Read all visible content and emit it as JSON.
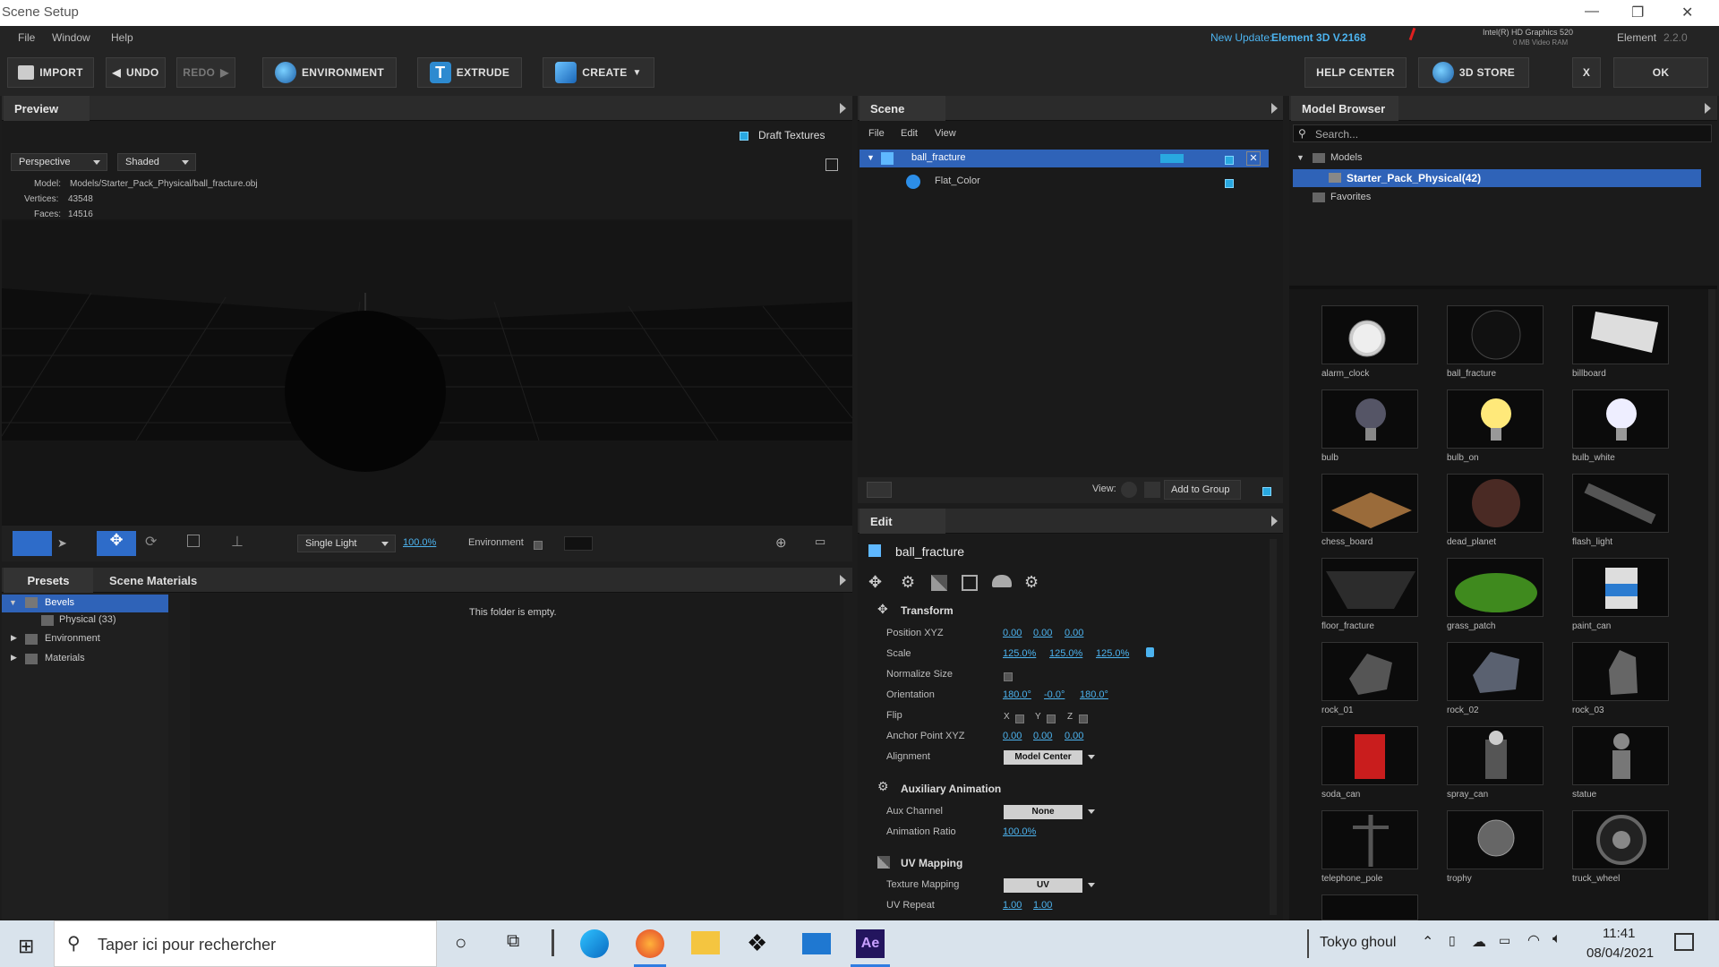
{
  "title": "Scene Setup",
  "menu": [
    "File",
    "Window",
    "Help"
  ],
  "update": {
    "prefix": "New Update:",
    "product": "Element 3D V.2168"
  },
  "gpu": {
    "name": "Intel(R) HD Graphics 520",
    "vram": "0 MB Video RAM"
  },
  "app": {
    "name": "Element",
    "version": "2.2.0"
  },
  "toolbar": {
    "import": "IMPORT",
    "undo": "UNDO",
    "redo": "REDO",
    "environment": "ENVIRONMENT",
    "extrude": "EXTRUDE",
    "create": "CREATE",
    "help": "HELP CENTER",
    "store": "3D STORE",
    "close": "X",
    "ok": "OK"
  },
  "preview": {
    "title": "Preview",
    "draft": "Draft Textures",
    "view": "Perspective",
    "shading": "Shaded",
    "model_label": "Model:",
    "model": "Models/Starter_Pack_Physical/ball_fracture.obj",
    "vertices_label": "Vertices:",
    "vertices": "43548",
    "faces_label": "Faces:",
    "faces": "14516",
    "light": "Single Light",
    "light_pct": "100.0%",
    "env": "Environment"
  },
  "presets": {
    "tab1": "Presets",
    "tab2": "Scene Materials",
    "tree": [
      "Bevels",
      "Physical (33)",
      "Environment",
      "Materials"
    ],
    "empty": "This folder is empty."
  },
  "scene": {
    "title": "Scene",
    "menu": [
      "File",
      "Edit",
      "View"
    ],
    "object": "ball_fracture",
    "material": "Flat_Color",
    "view": "View:",
    "add_group": "Add to Group"
  },
  "edit": {
    "title": "Edit",
    "object": "ball_fracture",
    "transform": "Transform",
    "position": "Position XYZ",
    "pos": [
      "0.00",
      "0.00",
      "0.00"
    ],
    "scale": "Scale",
    "sc": [
      "125.0%",
      "125.0%",
      "125.0%"
    ],
    "normalize": "Normalize Size",
    "orientation": "Orientation",
    "ori": [
      "180.0°",
      "-0.0°",
      "180.0°"
    ],
    "flip": "Flip",
    "flipx": "X",
    "flipy": "Y",
    "flipz": "Z",
    "anchor": "Anchor Point XYZ",
    "anc": [
      "0.00",
      "0.00",
      "0.00"
    ],
    "alignment": "Alignment",
    "align_val": "Model Center",
    "aux": "Auxiliary Animation",
    "aux_channel": "Aux Channel",
    "aux_val": "None",
    "anim_ratio": "Animation Ratio",
    "anim_val": "100.0%",
    "uv": "UV Mapping",
    "tex_map": "Texture Mapping",
    "tex_val": "UV",
    "uv_repeat": "UV Repeat",
    "uvr": [
      "1.00",
      "1.00"
    ]
  },
  "browser": {
    "title": "Model Browser",
    "search": "Search...",
    "models": "Models",
    "pack": "Starter_Pack_Physical(42)",
    "fav": "Favorites",
    "items": [
      "alarm_clock",
      "ball_fracture",
      "billboard",
      "bulb",
      "bulb_on",
      "bulb_white",
      "chess_board",
      "dead_planet",
      "flash_light",
      "floor_fracture",
      "grass_patch",
      "paint_can",
      "rock_01",
      "rock_02",
      "rock_03",
      "soda_can",
      "spray_can",
      "statue",
      "telephone_pole",
      "trophy",
      "truck_wheel"
    ]
  },
  "taskbar": {
    "search": "Taper ici pour rechercher",
    "weather": "Tokyo ghoul",
    "time": "11:41",
    "date": "08/04/2021"
  }
}
